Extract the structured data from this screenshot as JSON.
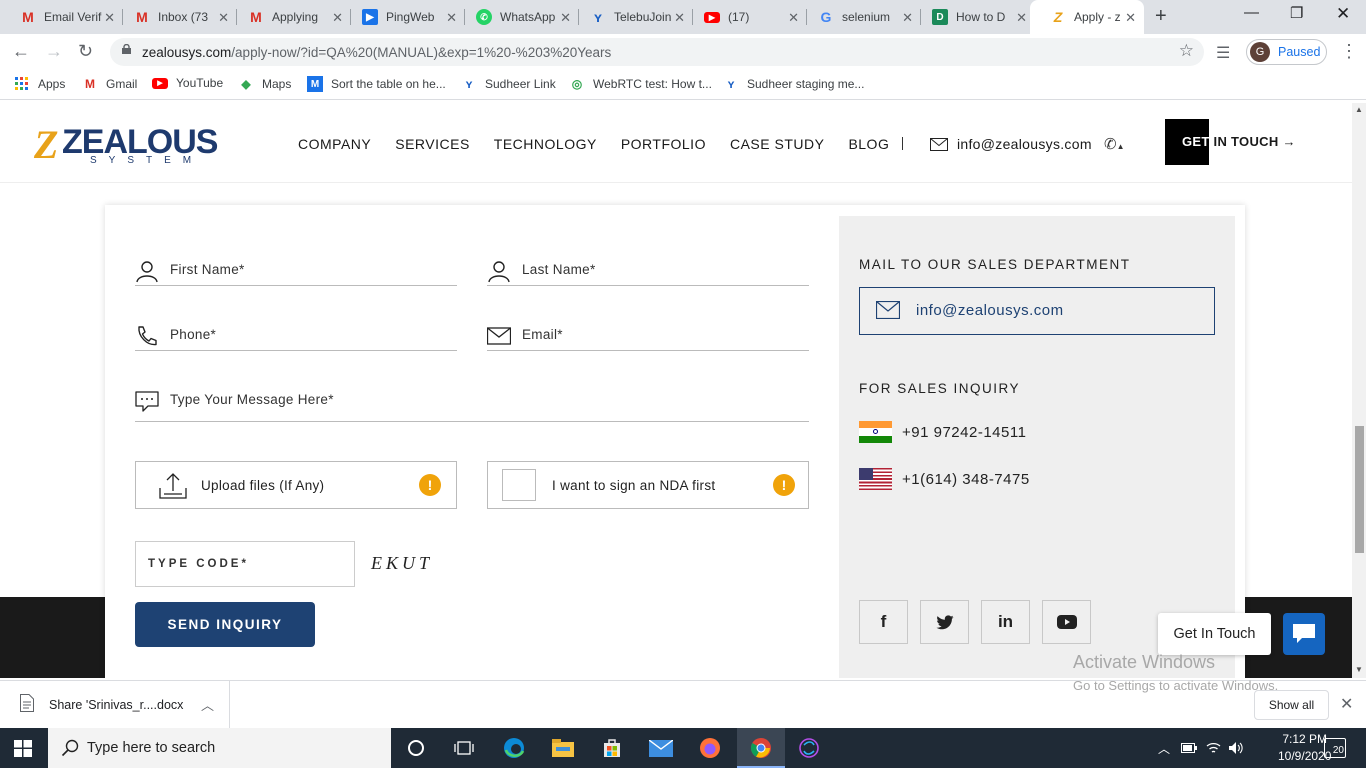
{
  "browser": {
    "tabs": [
      {
        "label": "Email Verifi",
        "icon": "gmail-icon",
        "active": false
      },
      {
        "label": "Inbox (73",
        "icon": "gmail-icon",
        "active": false
      },
      {
        "label": "Applying",
        "icon": "gmail-icon",
        "active": false
      },
      {
        "label": "PingWeb",
        "icon": "pingweb-icon",
        "active": false
      },
      {
        "label": "WhatsApp",
        "icon": "whatsapp-icon",
        "active": false
      },
      {
        "label": "TelebuJoin",
        "icon": "telebu-icon",
        "active": false
      },
      {
        "label": "(17) ",
        "icon": "youtube-icon",
        "active": false
      },
      {
        "label": "selenium",
        "icon": "google-icon",
        "active": false
      },
      {
        "label": "How to D",
        "icon": "dzone-icon",
        "active": false
      },
      {
        "label": "Apply - z",
        "icon": "zealous-icon",
        "active": true
      }
    ],
    "new_tab": "+",
    "window_controls": {
      "minimize": "—",
      "restore": "❐",
      "close": "✕"
    },
    "url_domain": "zealousys.com",
    "url_path": "/apply-now/?id=QA%20(MANUAL)&exp=1%20-%203%20Years",
    "profile": {
      "initial": "G",
      "status": "Paused"
    },
    "bookmarks": [
      {
        "label": "Apps",
        "icon": "apps-grid-icon"
      },
      {
        "label": "Gmail",
        "icon": "gmail-icon"
      },
      {
        "label": "YouTube",
        "icon": "youtube-icon"
      },
      {
        "label": "Maps",
        "icon": "maps-icon"
      },
      {
        "label": "Sort the table on he...",
        "icon": "m-icon"
      },
      {
        "label": "Sudheer Link",
        "icon": "telebu-icon"
      },
      {
        "label": "WebRTC test: How t...",
        "icon": "webrtc-icon"
      },
      {
        "label": "Sudheer staging me...",
        "icon": "telebu-icon"
      }
    ]
  },
  "site": {
    "logo_text": "ZEALOUS",
    "logo_sub": "SYSTEM",
    "nav": [
      "COMPANY",
      "SERVICES",
      "TECHNOLOGY",
      "PORTFOLIO",
      "CASE STUDY",
      "BLOG"
    ],
    "divider": "|",
    "email": "info@zealousys.com",
    "get_in_touch_dark": "GET",
    "get_in_touch_rest": " IN TOUCH →"
  },
  "form": {
    "first_name": "First Name*",
    "last_name": "Last Name*",
    "phone": "Phone*",
    "email": "Email*",
    "message": "Type Your Message Here*",
    "upload": "Upload files (If Any)",
    "nda": "I want to sign an NDA first",
    "warn_glyph": "!",
    "type_code": "TYPE CODE*",
    "captcha": "EKUT",
    "send": "SEND INQUIRY"
  },
  "sidebar": {
    "mail_heading": "MAIL TO OUR SALES DEPARTMENT",
    "mail": "info@zealousys.com",
    "sales_heading": "FOR SALES INQUIRY",
    "phone_in": "+91 97242-14511",
    "phone_us": "+1(614) 348-7475",
    "social": [
      "f",
      "twitter-icon",
      "in",
      "youtube-icon"
    ]
  },
  "floating": {
    "get_in_touch": "Get In Touch",
    "watermark_title": "Activate Windows",
    "watermark_sub": "Go to Settings to activate Windows."
  },
  "downloads": {
    "file": "Share 'Srinivas_r....docx",
    "show_all": "Show all"
  },
  "taskbar": {
    "search": "Type here to search",
    "time": "7:12 PM",
    "date": "10/9/2020",
    "notifications": "20"
  },
  "colors": {
    "brand_navy": "#1e4273",
    "brand_orange": "#e8a21a",
    "warn": "#f0a30a",
    "panel": "#efefef"
  }
}
